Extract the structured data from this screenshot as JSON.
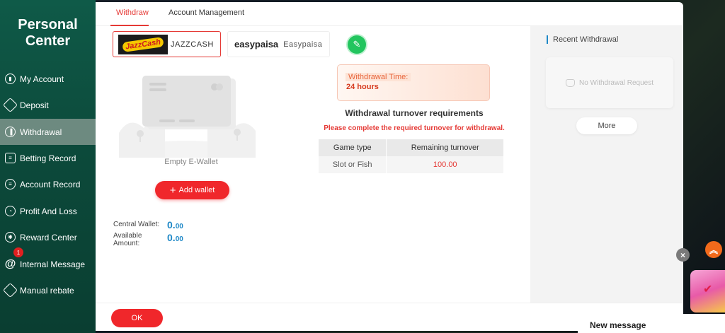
{
  "sidebar": {
    "title_line1": "Personal",
    "title_line2": "Center",
    "items": [
      {
        "label": "My Account"
      },
      {
        "label": "Deposit"
      },
      {
        "label": "Withdrawal"
      },
      {
        "label": "Betting Record"
      },
      {
        "label": "Account Record"
      },
      {
        "label": "Profit And Loss"
      },
      {
        "label": "Reward Center"
      },
      {
        "label": "Internal Message",
        "badge": "1"
      },
      {
        "label": "Manual rebate"
      }
    ],
    "active_item": "Withdrawal"
  },
  "tabs": [
    {
      "label": "Withdraw",
      "active": true
    },
    {
      "label": "Account Management",
      "active": false
    }
  ],
  "wallet_options": [
    {
      "logo_text": "JazzCash",
      "label": "JAZZCASH",
      "selected": true
    },
    {
      "logo_text": "easypaisa",
      "label": "Easypaisa",
      "selected": false
    }
  ],
  "empty_wallet_label": "Empty E-Wallet",
  "add_wallet_label": "Add wallet",
  "central_wallet": {
    "label": "Central Wallet:",
    "int": "0.",
    "dec": "00"
  },
  "available_amount": {
    "label_line1": "Available",
    "label_line2": "Amount:",
    "int": "0.",
    "dec": "00"
  },
  "withdrawal_time": {
    "label": "Withdrawal Time:",
    "value": "24 hours"
  },
  "turnover": {
    "title": "Withdrawal turnover requirements",
    "note": "Please complete the required turnover for withdrawal.",
    "columns": [
      "Game type",
      "Remaining turnover"
    ],
    "rows": [
      {
        "game_type": "Slot or Fish",
        "remaining": "100.00"
      }
    ]
  },
  "recent": {
    "title": "Recent Withdrawal",
    "empty_text": "No Withdrawal Request",
    "more_label": "More"
  },
  "footer": {
    "ok_label": "OK"
  },
  "overlay": {
    "new_message_label": "New message"
  },
  "colors": {
    "accent_red": "#f0272b",
    "sidebar_green": "#0c4a3b",
    "amount_blue": "#1e88c7",
    "edit_green": "#22c55e"
  }
}
